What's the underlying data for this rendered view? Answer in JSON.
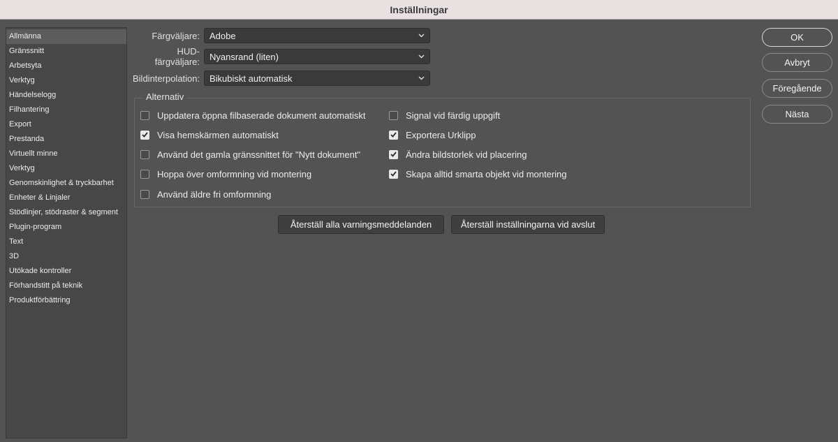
{
  "window": {
    "title": "Inställningar"
  },
  "sidebar": {
    "items": [
      {
        "label": "Allmänna",
        "selected": true
      },
      {
        "label": "Gränssnitt"
      },
      {
        "label": "Arbetsyta"
      },
      {
        "label": "Verktyg"
      },
      {
        "label": "Händelselogg"
      },
      {
        "label": "Filhantering"
      },
      {
        "label": "Export"
      },
      {
        "label": "Prestanda"
      },
      {
        "label": "Virtuellt minne"
      },
      {
        "label": "Verktyg"
      },
      {
        "label": "Genomskinlighet & tryckbarhet"
      },
      {
        "label": "Enheter & Linjaler"
      },
      {
        "label": "Stödlinjer, stödraster & segment"
      },
      {
        "label": "Plugin-program"
      },
      {
        "label": "Text"
      },
      {
        "label": "3D"
      },
      {
        "label": "Utökade kontroller"
      },
      {
        "label": "Förhandstitt på teknik"
      },
      {
        "label": "Produktförbättring"
      }
    ]
  },
  "fields": {
    "color_picker": {
      "label": "Färgväljare:",
      "value": "Adobe"
    },
    "hud_color_picker": {
      "label": "HUD-färgväljare:",
      "value": "Nyansrand (liten)"
    },
    "image_interpolation": {
      "label": "Bildinterpolation:",
      "value": "Bikubiskt automatisk"
    }
  },
  "options": {
    "legend": "Alternativ",
    "left": [
      {
        "label": "Uppdatera öppna filbaserade dokument automatiskt",
        "checked": false
      },
      {
        "label": "Visa hemskärmen automatiskt",
        "checked": true
      },
      {
        "label": "Använd det gamla gränssnittet för \"Nytt dokument\"",
        "checked": false
      },
      {
        "label": "Hoppa över omformning vid montering",
        "checked": false
      },
      {
        "label": "Använd äldre fri omformning",
        "checked": false
      }
    ],
    "right": [
      {
        "label": "Signal vid färdig uppgift",
        "checked": false
      },
      {
        "label": "Exportera Urklipp",
        "checked": true
      },
      {
        "label": "Ändra bildstorlek vid placering",
        "checked": true
      },
      {
        "label": "Skapa alltid smarta objekt vid montering",
        "checked": true
      }
    ]
  },
  "reset_buttons": {
    "reset_warnings": "Återställ alla varningsmeddelanden",
    "reset_on_quit": "Återställ inställningarna vid avslut"
  },
  "dialog_buttons": {
    "ok": "OK",
    "cancel": "Avbryt",
    "previous": "Föregående",
    "next": "Nästa"
  },
  "icons": {
    "dropdown": "chevron-down-icon",
    "checkbox_mark": "checkmark-icon"
  }
}
